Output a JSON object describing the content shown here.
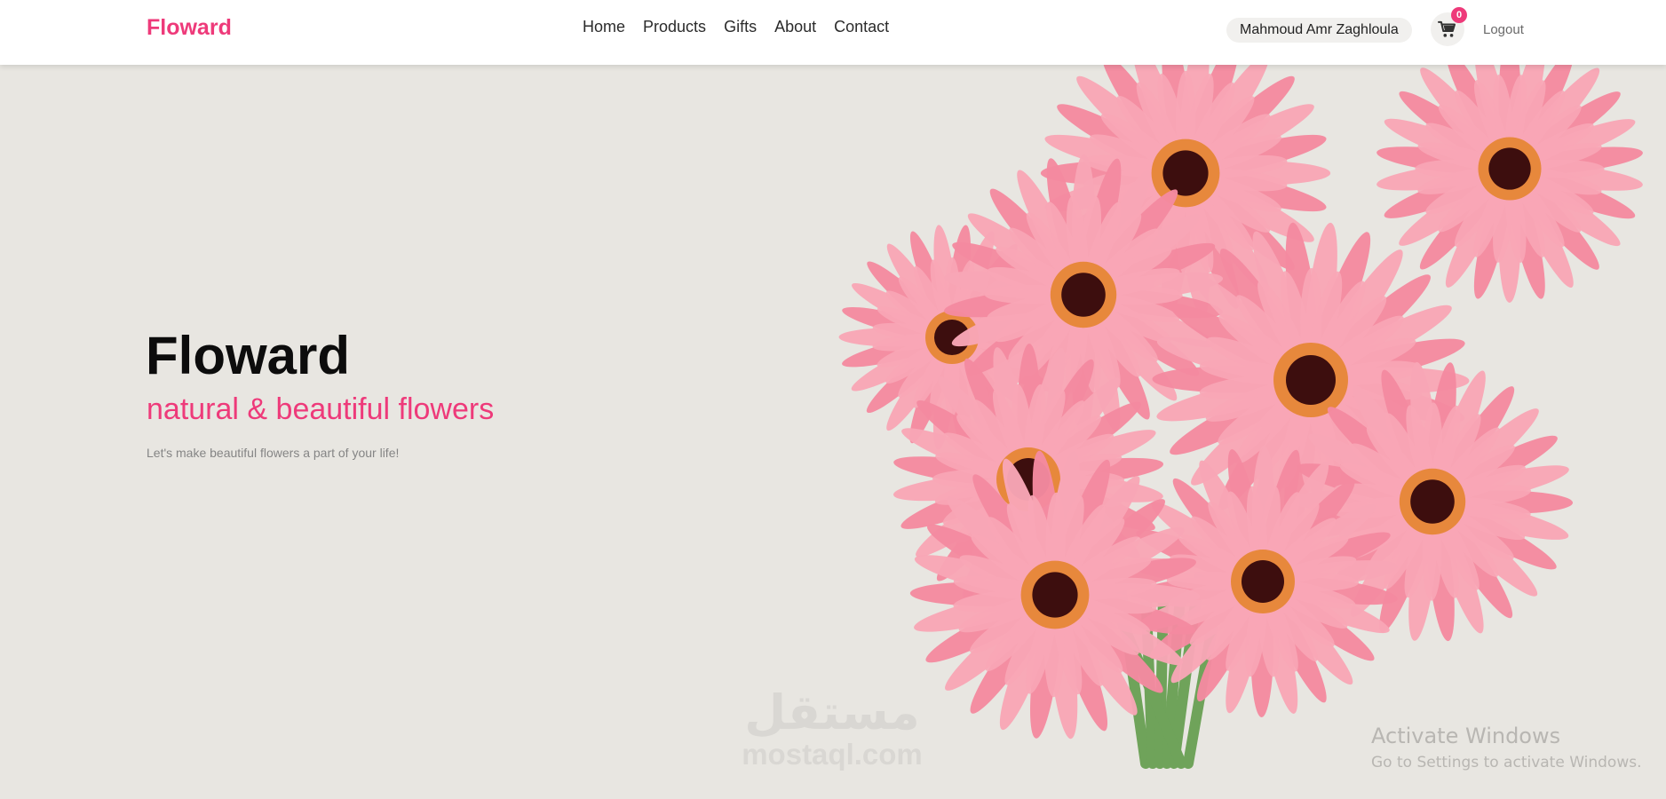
{
  "navbar": {
    "brand": "Floward",
    "links": [
      "Home",
      "Products",
      "Gifts",
      "About",
      "Contact"
    ],
    "user_name": "Mahmoud Amr Zaghloula",
    "cart_count": "0",
    "logout": "Logout",
    "cart_icon": "cart-icon"
  },
  "hero": {
    "title": "Floward",
    "subtitle": "natural & beautiful flowers",
    "text": "Let's make beautiful flowers a part of your life!",
    "image": "pink-gerbera-bouquet"
  },
  "watermark": {
    "arabic": "مستقل",
    "latin": "mostaql.com"
  },
  "activation": {
    "title": "Activate Windows",
    "subtitle": "Go to Settings to activate Windows."
  },
  "colors": {
    "accent": "#ee3a7a",
    "background": "#e8e6e1",
    "petal": "#f48aa0",
    "petal_light": "#f8a6b6",
    "center_dark": "#3d0e0e",
    "center_ring": "#e7883c",
    "stem": "#6fa35a"
  }
}
